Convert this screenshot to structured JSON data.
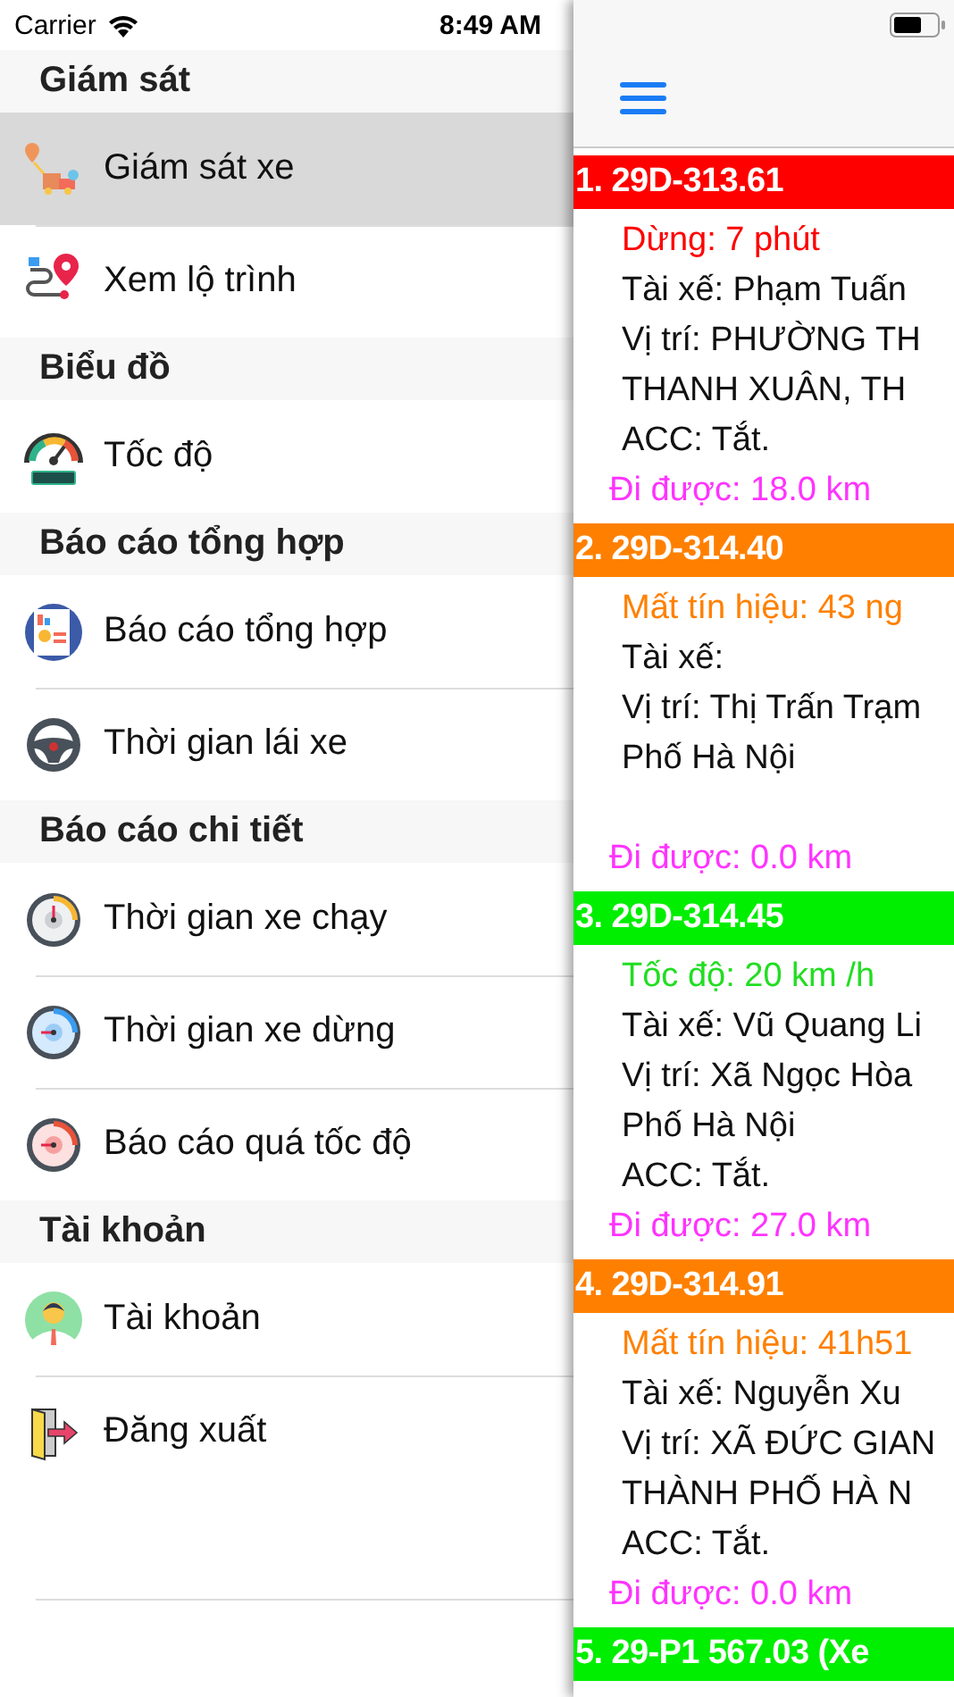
{
  "status_bar": {
    "carrier": "Carrier",
    "time": "8:49 AM"
  },
  "menu": [
    {
      "title": "Giám sát",
      "items": [
        {
          "label": "Giám sát xe",
          "kind": "pin-truck",
          "selected": true
        },
        {
          "label": "Xem lộ trình",
          "kind": "route",
          "selected": false
        }
      ]
    },
    {
      "title": "Biểu đồ",
      "items": [
        {
          "label": "Tốc độ",
          "kind": "speedometer",
          "selected": false
        }
      ]
    },
    {
      "title": "Báo cáo tổng hợp",
      "items": [
        {
          "label": "Báo cáo tổng hợp",
          "kind": "report",
          "selected": false
        },
        {
          "label": "Thời gian lái xe",
          "kind": "steering",
          "selected": false
        }
      ]
    },
    {
      "title": "Báo cáo chi tiết",
      "items": [
        {
          "label": "Thời gian xe chạy",
          "kind": "gauge-gray",
          "selected": false
        },
        {
          "label": "Thời gian xe dừng",
          "kind": "gauge-blue",
          "selected": false
        },
        {
          "label": "Báo cáo quá tốc độ",
          "kind": "gauge-red",
          "selected": false
        }
      ]
    },
    {
      "title": "Tài khoản",
      "items": [
        {
          "label": "Tài khoản",
          "kind": "avatar",
          "selected": false
        },
        {
          "label": "Đăng xuất",
          "kind": "logout",
          "selected": false
        }
      ]
    }
  ],
  "vehicles": [
    {
      "title": "1. 29D-313.61",
      "color": "#ff0000",
      "status": "Dừng: 7 phút",
      "kind": "stopped",
      "lines": [
        "Tài xế: Phạm Tuấn",
        "Vị trí: PHƯỜNG TH",
        "THANH XUÂN, TH",
        "ACC: Tắt."
      ],
      "distance": "Đi được: 18.0 km"
    },
    {
      "title": "2. 29D-314.40",
      "color": "#ff8000",
      "status": "Mất tín hiệu: 43 ng",
      "kind": "lost",
      "lines": [
        "Tài xế:",
        "Vị trí: Thị Trấn Trạm",
        "Phố Hà Nội"
      ],
      "distance": "Đi được: 0.0 km"
    },
    {
      "title": "3. 29D-314.45",
      "color": "#00ee00",
      "status": "Tốc độ: 20 km /h",
      "kind": "moving",
      "lines": [
        "Tài xế: Vũ Quang Li",
        "Vị trí: Xã Ngọc Hòa",
        "Phố Hà Nội",
        "ACC: Tắt."
      ],
      "distance": "Đi được: 27.0 km"
    },
    {
      "title": "4. 29D-314.91",
      "color": "#ff8000",
      "status": "Mất tín hiệu: 41h51",
      "kind": "lost",
      "lines": [
        "Tài xế: Nguyễn Xu",
        "Vị trí: XÃ ĐỨC GIAN",
        "THÀNH PHỐ HÀ N",
        "ACC: Tắt."
      ],
      "distance": "Đi được: 0.0 km"
    },
    {
      "title": "5. 29-P1 567.03 (Xe",
      "color": "#00ee00"
    }
  ]
}
